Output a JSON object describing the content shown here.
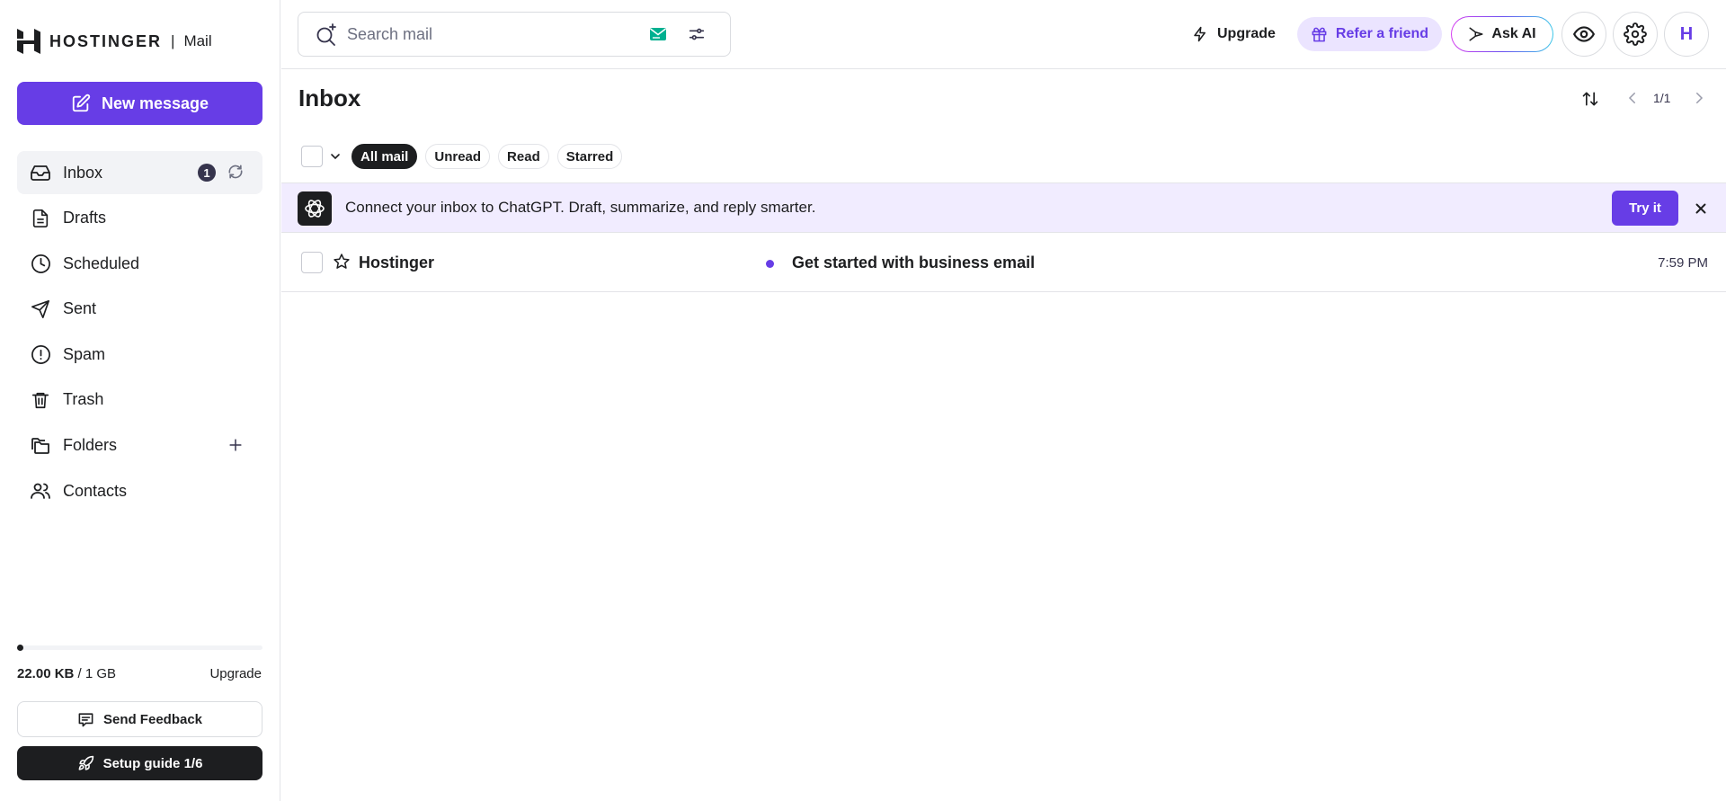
{
  "app": {
    "brand": "HOSTINGER",
    "separator": "|",
    "product": "Mail"
  },
  "sidebar": {
    "new_message": "New message",
    "items": [
      {
        "label": "Inbox",
        "icon": "inbox-icon",
        "badge": "1"
      },
      {
        "label": "Drafts",
        "icon": "draft-icon"
      },
      {
        "label": "Scheduled",
        "icon": "clock-icon"
      },
      {
        "label": "Sent",
        "icon": "send-icon"
      },
      {
        "label": "Spam",
        "icon": "alert-icon"
      },
      {
        "label": "Trash",
        "icon": "trash-icon"
      },
      {
        "label": "Folders",
        "icon": "folders-icon"
      },
      {
        "label": "Contacts",
        "icon": "contacts-icon"
      }
    ],
    "storage": {
      "used": "22.00 KB",
      "total": "/ 1 GB",
      "upgrade": "Upgrade",
      "used_fraction": 2e-05
    },
    "feedback": "Send Feedback",
    "setup": "Setup guide 1/6"
  },
  "header": {
    "search_placeholder": "Search mail",
    "upgrade": "Upgrade",
    "refer": "Refer a friend",
    "ask_ai": "Ask AI",
    "avatar": "H"
  },
  "main": {
    "title": "Inbox",
    "pager": "1/1",
    "filters": [
      "All mail",
      "Unread",
      "Read",
      "Starred"
    ],
    "banner": {
      "text": "Connect your inbox to ChatGPT. Draft, summarize, and reply smarter.",
      "button": "Try it"
    },
    "emails": [
      {
        "sender": "Hostinger",
        "subject": "Get started with business email",
        "time": "7:59 PM",
        "unread": true
      }
    ]
  },
  "colors": {
    "accent": "#673de6",
    "accent_light": "#ebe4ff",
    "dark": "#1d1e20",
    "banner_bg": "#f1ecff"
  }
}
